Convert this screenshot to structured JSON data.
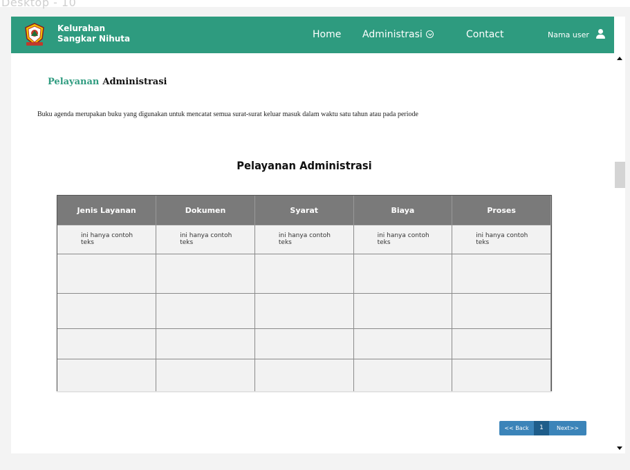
{
  "frame": {
    "label": "Desktop - 10"
  },
  "navbar": {
    "brand_line1": "Kelurahan",
    "brand_line2": "Sangkar Nihuta",
    "home": "Home",
    "administrasi": "Administrasi",
    "contact": "Contact",
    "user": "Nama user",
    "bg_color": "#2e9b7f"
  },
  "page": {
    "title_part1": "Pelayanan",
    "title_part2": "Administrasi",
    "description": "Buku agenda merupakan buku yang digunakan untuk mencatat semua surat-surat keluar masuk dalam waktu satu tahun atau pada periode",
    "table_title": "Pelayanan Administrasi"
  },
  "table": {
    "headers": [
      "Jenis Layanan",
      "Dokumen",
      "Syarat",
      "Biaya",
      "Proses"
    ],
    "rows": [
      [
        "ini hanya contoh teks",
        "ini hanya contoh teks",
        "ini hanya contoh teks",
        "ini hanya contoh teks",
        "ini hanya contoh teks"
      ],
      [
        "",
        "",
        "",
        "",
        ""
      ],
      [
        "",
        "",
        "",
        "",
        ""
      ],
      [
        "",
        "",
        "",
        "",
        ""
      ],
      [
        "",
        "",
        "",
        "",
        ""
      ]
    ]
  },
  "pagination": {
    "back": "<< Back",
    "current": "1",
    "next": "Next>>"
  }
}
